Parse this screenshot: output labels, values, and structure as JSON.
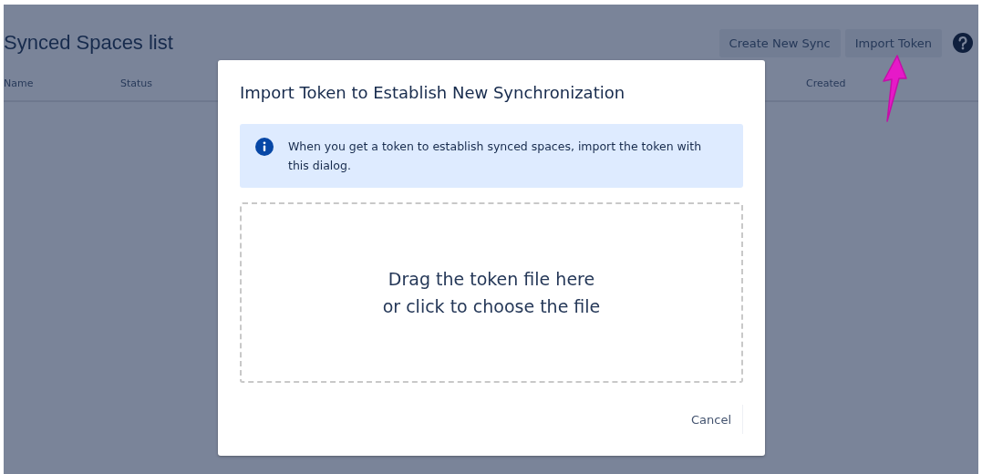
{
  "page": {
    "title": "Synced Spaces list",
    "buttons": [
      "Create New Sync",
      "Import Token"
    ],
    "columns": [
      "Name",
      "Status",
      "Created"
    ]
  },
  "dialog": {
    "title": "Import Token to Establish New Synchronization",
    "info": "When you get a token to establish synced spaces, import the token with this dialog.",
    "dropzone": [
      "Drag the token file here",
      "or click to choose the file"
    ],
    "buttons": [
      "Cancel"
    ]
  }
}
